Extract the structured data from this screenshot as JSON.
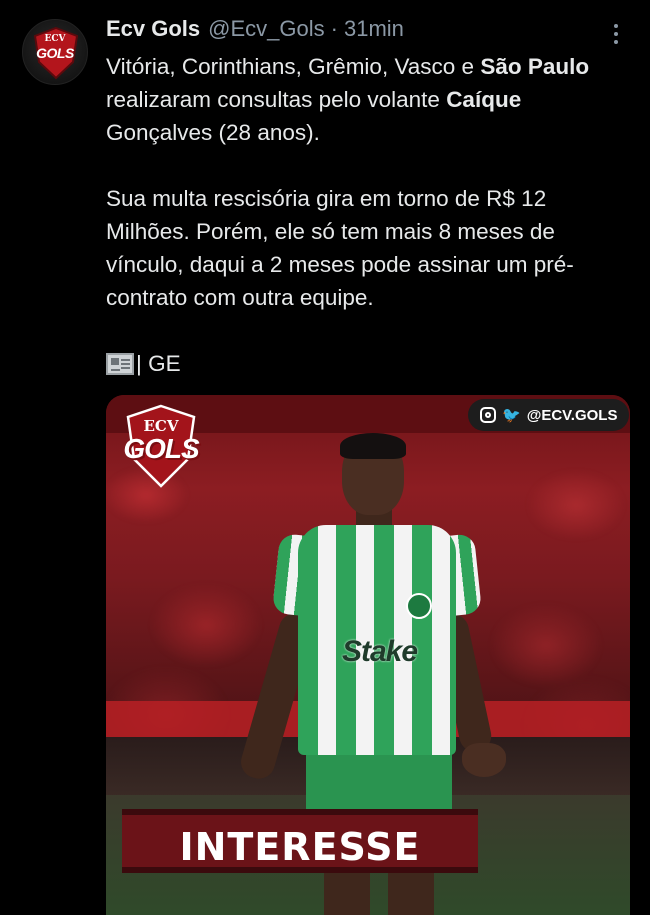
{
  "author": {
    "name": "Ecv Gols",
    "handle": "@Ecv_Gols",
    "separator": "·",
    "time": "31min",
    "avatar": {
      "top": "ECV",
      "main": "GOLS"
    }
  },
  "tweet": {
    "p1_a": "Vitória, Corinthians, Grêmio, Vasco e ",
    "p1_b": "São Paulo",
    "p1_c": " realizaram consultas pelo volante ",
    "p1_d": "Caíque",
    "p1_e": " Gonçalves (28 anos).",
    "p2": "Sua multa rescisória gira em torno de R$ 12 Milhões. Porém, ele só tem mais 8 meses de vínculo, daqui a 2 meses pode assinar um pré-contrato com outra equipe.",
    "source": "| GE"
  },
  "media": {
    "logo_top": "ECV",
    "logo_main": "GOLS",
    "social_handle": "@ECV.GOLS",
    "sponsor": "Stake",
    "banner": "INTERESSE"
  },
  "icons": {
    "more": "more-options-icon",
    "news": "newspaper-icon",
    "instagram": "instagram-icon",
    "twitter": "twitter-icon"
  },
  "colors": {
    "background": "#000000",
    "text": "#e7e9ea",
    "muted": "#8b98a5",
    "brand_red": "#6b1318",
    "jersey_green": "#2fa35a"
  }
}
